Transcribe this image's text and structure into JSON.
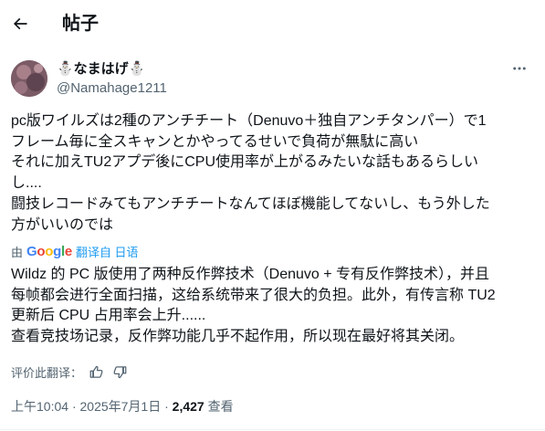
{
  "header": {
    "title": "帖子",
    "back_icon": "arrow-left-icon"
  },
  "author": {
    "display_name": "⛄なまはげ⛄",
    "handle": "@Namahage1211",
    "avatar": "avatar-image",
    "more_icon": "more-horizontal-icon"
  },
  "post": {
    "lines": [
      "pc版ワイルズは2種のアンチチート（Denuvo＋独自アンチタンパー）で1",
      "フレーム毎に全スキャンとかやってるせいで負荷が無駄に高い",
      "それに加えTU2アプデ後にCPU使用率が上がるみたいな話もあるらしい",
      "し....",
      "闘技レコードみてもアンチチートなんてほぼ機能してないし、もう外した",
      "方がいいのでは"
    ]
  },
  "translation": {
    "by_prefix": "由",
    "provider": "Google",
    "link_text": "翻译自 日语",
    "lines": [
      "Wildz 的 PC 版使用了两种反作弊技术（Denuvo + 专有反作弊技术），并且",
      "每帧都会进行全面扫描，这给系统带来了很大的负担。此外，有传言称 TU2",
      "更新后 CPU 占用率会上升......",
      "查看竞技场记录，反作弊功能几乎不起作用，所以现在最好将其关闭。"
    ],
    "rate_label": "评价此翻译：",
    "thumb_up_icon": "thumbs-up-icon",
    "thumb_down_icon": "thumbs-down-icon"
  },
  "meta": {
    "time": "上午10:04",
    "separator": "·",
    "date": "2025年7月1日",
    "views_count": "2,427",
    "views_label": "查看"
  },
  "colors": {
    "text": "#0f1419",
    "secondary": "#536471",
    "link": "#1d9bf0"
  }
}
